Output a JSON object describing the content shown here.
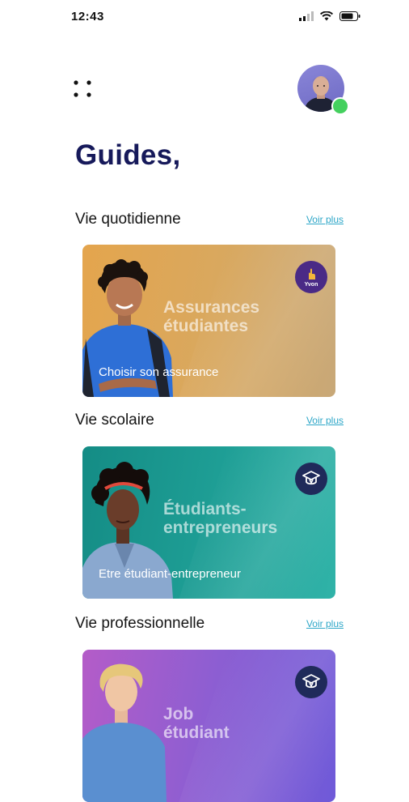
{
  "status_bar": {
    "time": "12:43"
  },
  "header": {
    "title": "Guides,"
  },
  "sections": [
    {
      "title": "Vie quotidienne",
      "see_more": "Voir plus",
      "card": {
        "title_line1": "Assurances",
        "title_line2": "étudiantes",
        "subtitle": "Choisir son assurance",
        "badge_label": "Yvon",
        "badge_icon": "hand-icon",
        "colors": {
          "from": "#e8a84a",
          "to": "#c9a871"
        }
      }
    },
    {
      "title": "Vie scolaire",
      "see_more": "Voir plus",
      "card": {
        "title_line1": "Étudiants-",
        "title_line2": "entrepreneurs",
        "subtitle": "Etre étudiant-entrepreneur",
        "badge_label": "",
        "badge_icon": "graduation-cap-icon",
        "colors": {
          "from": "#1a9088",
          "to": "#2ab0a6"
        }
      }
    },
    {
      "title": "Vie professionnelle",
      "see_more": "Voir plus",
      "card": {
        "title_line1": "Job",
        "title_line2": "étudiant",
        "subtitle": "",
        "badge_label": "",
        "badge_icon": "graduation-cap-icon",
        "colors": {
          "from": "#a35bd0",
          "to": "#6f5bd9"
        }
      }
    }
  ],
  "colors": {
    "title": "#16195a",
    "link": "#2ea7c8",
    "online": "#44d05e"
  }
}
